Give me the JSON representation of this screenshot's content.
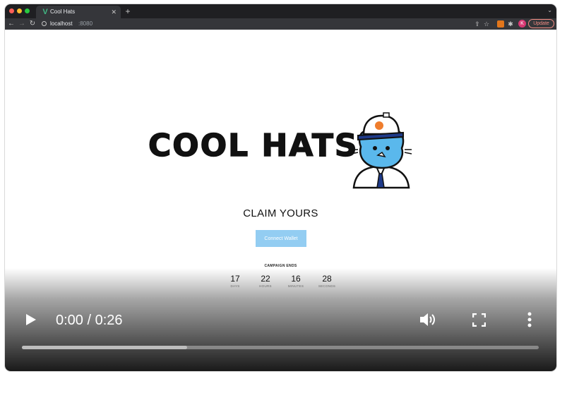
{
  "browser": {
    "tab_title": "Cool Hats",
    "tab_favicon": "vue-favicon-icon",
    "url_host": "localhost",
    "url_port": ":8080",
    "profile_initial": "K",
    "update_label": "Update",
    "colors": {
      "chrome_dark": "#1f1f22",
      "toolbar": "#35363a",
      "update_accent": "#f28b82"
    }
  },
  "page": {
    "logo_text": "COOL HATS",
    "claim_title": "CLAIM YOURS",
    "connect_button_label": "Connect Wallet",
    "campaign_label": "CAMPAIGN ENDS",
    "countdown": [
      {
        "value": "17",
        "label": "DAYS"
      },
      {
        "value": "22",
        "label": "HOURS"
      },
      {
        "value": "16",
        "label": "MINUTES"
      },
      {
        "value": "28",
        "label": "SECONDS"
      }
    ],
    "colors": {
      "connect_button": "#93cdf2",
      "mascot_body": "#5ab8ec",
      "hat_badge": "#ef7d2d"
    }
  },
  "video": {
    "time_display": "0:00 / 0:26",
    "progress_fraction": 0.32,
    "icons": [
      "play-icon",
      "volume-icon",
      "fullscreen-icon",
      "more-vert-icon"
    ]
  }
}
